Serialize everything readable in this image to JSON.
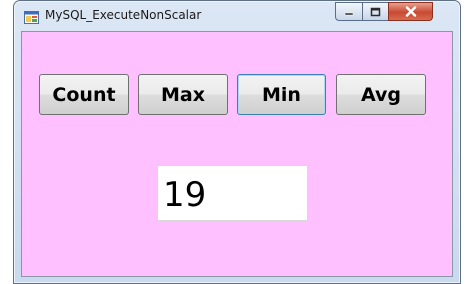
{
  "window": {
    "title": "MySQL_ExecuteNonScalar",
    "icon": "winforms-app-icon",
    "controls": [
      "minimize-icon",
      "maximize-icon",
      "close-icon"
    ]
  },
  "form": {
    "background": "#ffc0ff",
    "buttons": {
      "count": "Count",
      "max": "Max",
      "min": "Min",
      "avg": "Avg"
    },
    "focused_button": "Min",
    "result_value": "19"
  }
}
